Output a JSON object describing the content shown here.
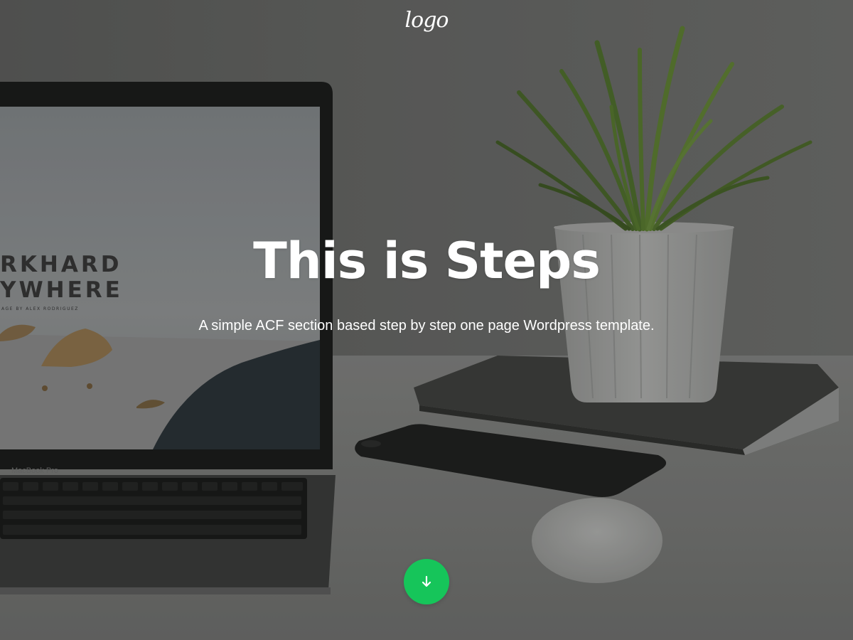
{
  "header": {
    "logo_text": "logo"
  },
  "hero": {
    "title": "This is Steps",
    "subtitle": "A simple ACF section based step by step one page Wordpress template.",
    "scroll_button_icon": "arrow-down-icon",
    "accent_color": "#16c55a"
  },
  "background_photo": {
    "laptop_screen_line1": "RKHARD",
    "laptop_screen_line2": "YWHERE",
    "laptop_screen_caption": "AGE BY ALEX RODRIGUEZ",
    "laptop_brand": "MacBook Pro"
  }
}
